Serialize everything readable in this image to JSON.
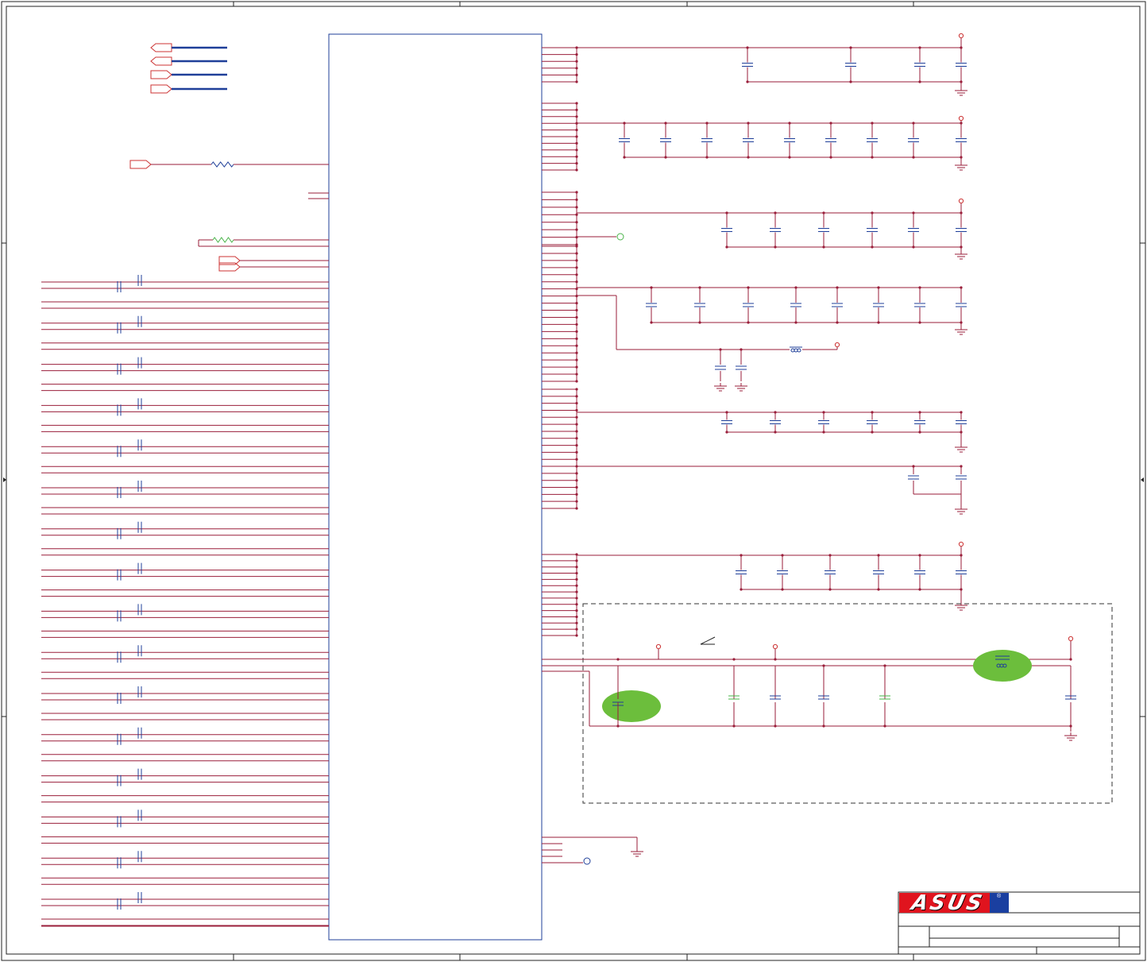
{
  "title_block": {
    "company_logo": "ASUS",
    "registered_mark": "®"
  },
  "colors": {
    "wire": "#9a1e3a",
    "bus": "#1f3f99",
    "part": "#1f3f99",
    "port": "#cc3333",
    "power": "#cc3333",
    "frame": "#222222",
    "highlight": "#6cbe3c",
    "alt_part": "#49b449",
    "dashed_region": "#333333"
  },
  "icons": [
    "capacitor-icon",
    "resistor-icon",
    "ground-icon",
    "power-pin-icon",
    "port-icon",
    "inductor-icon",
    "logo-icon"
  ]
}
